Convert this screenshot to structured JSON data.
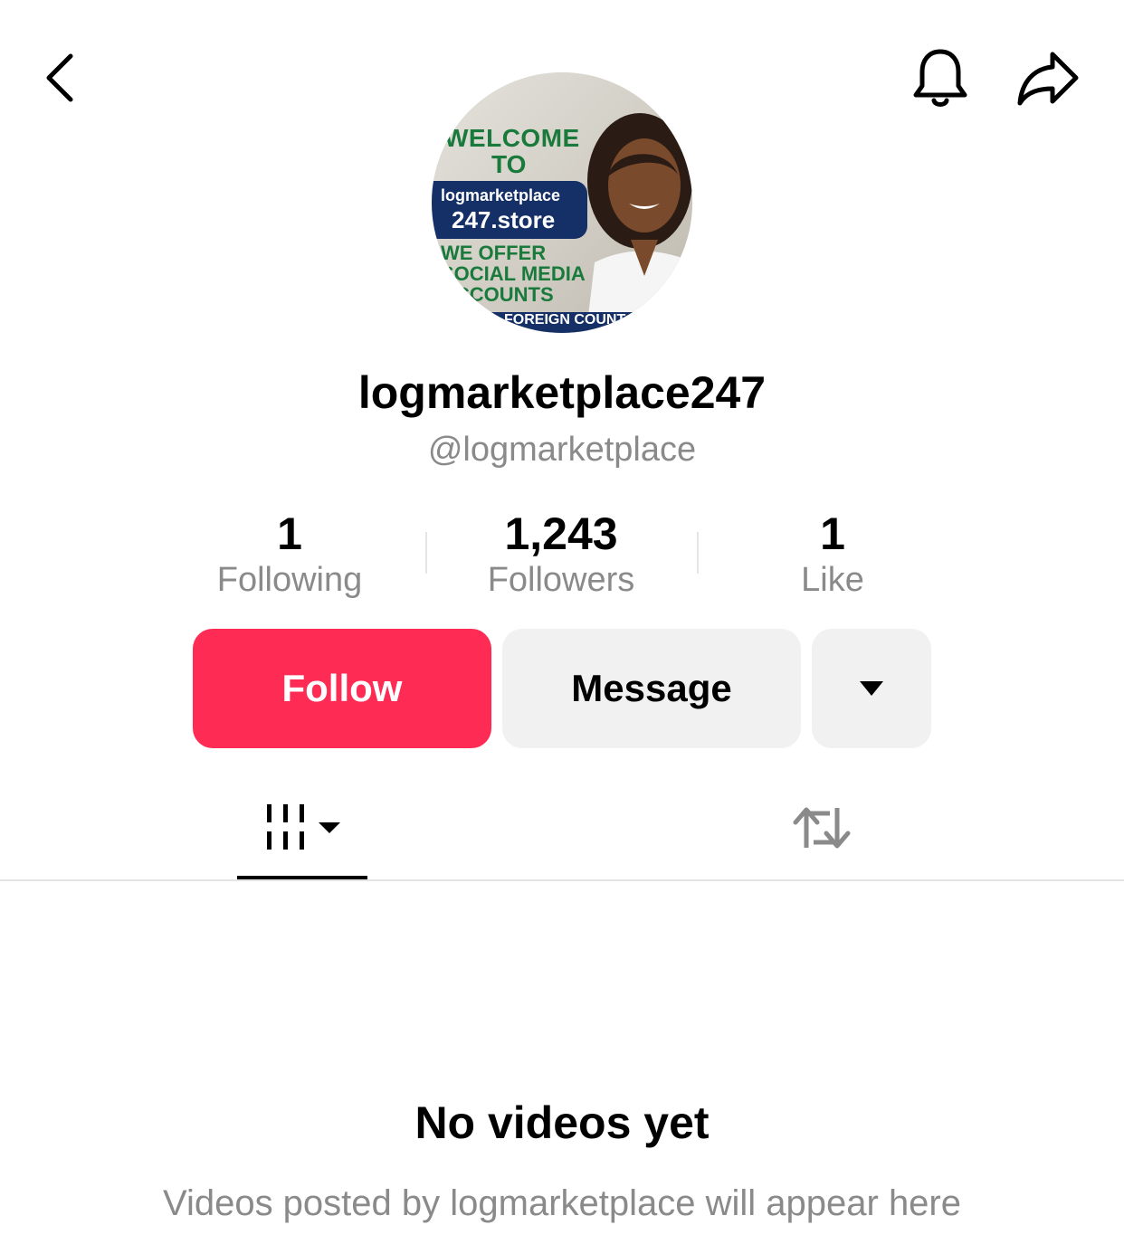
{
  "header": {
    "back_icon": "chevron-left-icon",
    "bell_icon": "bell-icon",
    "share_icon": "share-arrow-icon"
  },
  "avatar": {
    "welcome": "WELCOME",
    "to": "TO",
    "site_line1": "logmarketplace",
    "site_line2": "247.store",
    "offer": "WE OFFER SOCIAL MEDIA ACCOUNTS",
    "band": "FOREIGN COUNT"
  },
  "profile": {
    "display_name": "logmarketplace247",
    "handle": "@logmarketplace"
  },
  "stats": [
    {
      "value": "1",
      "label": "Following"
    },
    {
      "value": "1,243",
      "label": "Followers"
    },
    {
      "value": "1",
      "label": "Like"
    }
  ],
  "actions": {
    "follow": "Follow",
    "message": "Message",
    "more_icon": "caret-down-icon"
  },
  "tabs": {
    "videos_icon": "video-grid-icon",
    "repost_icon": "repost-icon",
    "active": "videos"
  },
  "empty_state": {
    "title": "No videos yet",
    "subtitle": "Videos posted by logmarketplace will appear here"
  },
  "colors": {
    "accent": "#fe2c55",
    "secondary_bg": "#f1f1f2",
    "muted_text": "#8a8a8a"
  }
}
